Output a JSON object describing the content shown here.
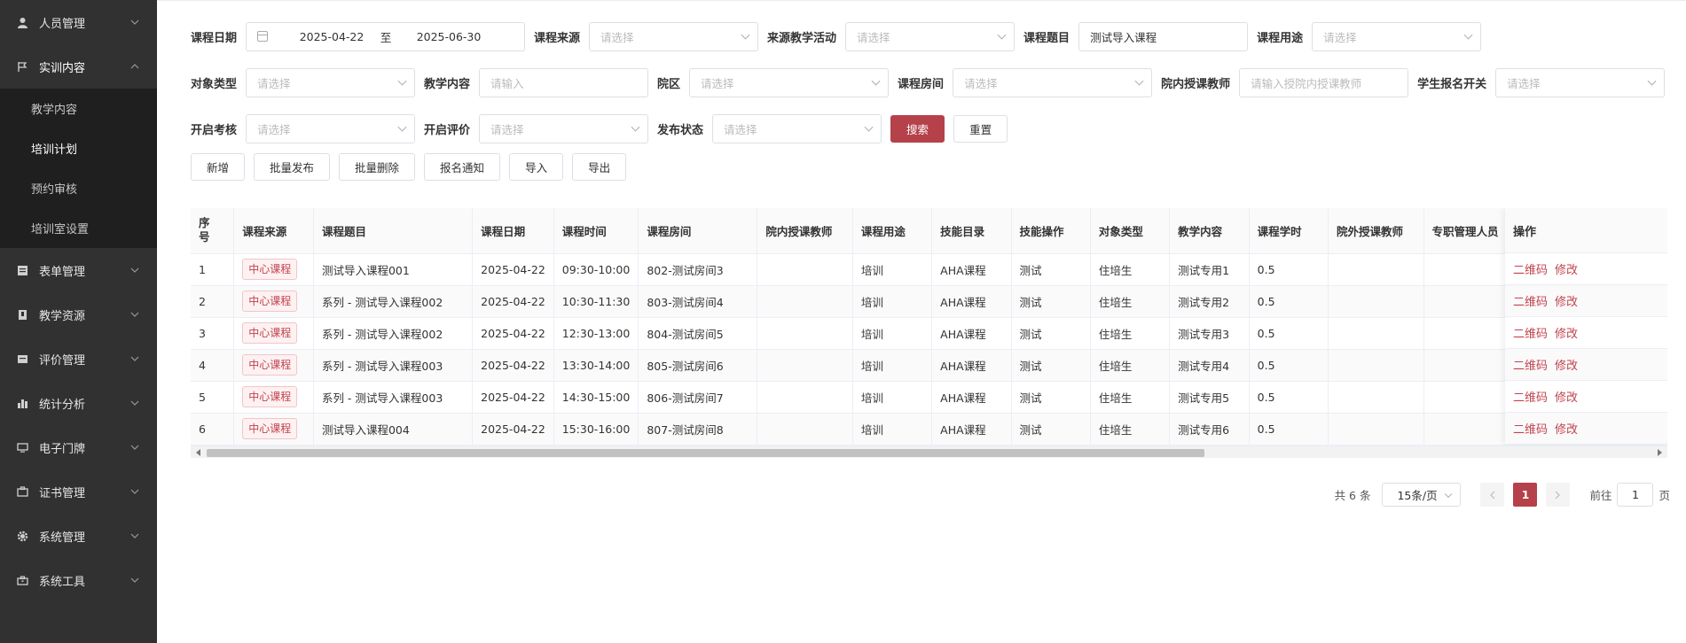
{
  "sidebar": {
    "items": [
      {
        "label": "人员管理",
        "icon": "user-icon"
      },
      {
        "label": "实训内容",
        "icon": "flag-icon",
        "expanded": true,
        "children": [
          {
            "label": "教学内容"
          },
          {
            "label": "培训计划",
            "active": true
          },
          {
            "label": "预约审核"
          },
          {
            "label": "培训室设置"
          }
        ]
      },
      {
        "label": "表单管理",
        "icon": "form-icon"
      },
      {
        "label": "教学资源",
        "icon": "book-icon"
      },
      {
        "label": "评价管理",
        "icon": "card-icon"
      },
      {
        "label": "统计分析",
        "icon": "bar-chart-icon"
      },
      {
        "label": "电子门牌",
        "icon": "monitor-icon"
      },
      {
        "label": "证书管理",
        "icon": "certificate-icon"
      },
      {
        "label": "系统管理",
        "icon": "gear-icon"
      },
      {
        "label": "系统工具",
        "icon": "toolbox-icon"
      }
    ]
  },
  "filters": {
    "course_date": {
      "label": "课程日期",
      "start": "2025-04-22",
      "sep": "至",
      "end": "2025-06-30"
    },
    "course_source": {
      "label": "课程来源",
      "placeholder": "请选择"
    },
    "source_activity": {
      "label": "来源教学活动",
      "placeholder": "请选择"
    },
    "course_title": {
      "label": "课程题目",
      "value": "测试导入课程"
    },
    "course_usage": {
      "label": "课程用途",
      "placeholder": "请选择"
    },
    "target_type": {
      "label": "对象类型",
      "placeholder": "请选择"
    },
    "teaching_content": {
      "label": "教学内容",
      "placeholder": "请输入"
    },
    "campus": {
      "label": "院区",
      "placeholder": "请选择"
    },
    "course_room": {
      "label": "课程房间",
      "placeholder": "请选择"
    },
    "internal_teacher": {
      "label": "院内授课教师",
      "placeholder": "请输入授院内授课教师"
    },
    "student_signup": {
      "label": "学生报名开关",
      "placeholder": "请选择"
    },
    "enable_exam": {
      "label": "开启考核",
      "placeholder": "请选择"
    },
    "enable_eval": {
      "label": "开启评价",
      "placeholder": "请选择"
    },
    "publish_status": {
      "label": "发布状态",
      "placeholder": "请选择"
    },
    "search_label": "搜索",
    "reset_label": "重置"
  },
  "toolbar": {
    "add": "新增",
    "batch_publish": "批量发布",
    "batch_delete": "批量删除",
    "signup_notice": "报名通知",
    "import": "导入",
    "export": "导出"
  },
  "table": {
    "headers": [
      "序号",
      "课程来源",
      "课程题目",
      "课程日期",
      "课程时间",
      "课程房间",
      "院内授课教师",
      "课程用途",
      "技能目录",
      "技能操作",
      "对象类型",
      "教学内容",
      "课程学时",
      "院外授课教师",
      "专职管理人员",
      "操作"
    ],
    "rows": [
      {
        "no": "1",
        "source": "中心课程",
        "title": "测试导入课程001",
        "date": "2025-04-22",
        "time": "09:30-10:00",
        "room": "802-测试房间3",
        "teacher": "",
        "usage": "培训",
        "skill_dir": "AHA课程",
        "skill_op": "测试",
        "target": "住培生",
        "content": "测试专用1",
        "hours": "0.5",
        "ext_teacher": "",
        "manager": ""
      },
      {
        "no": "2",
        "source": "中心课程",
        "title": "系列 - 测试导入课程002",
        "date": "2025-04-22",
        "time": "10:30-11:30",
        "room": "803-测试房间4",
        "teacher": "",
        "usage": "培训",
        "skill_dir": "AHA课程",
        "skill_op": "测试",
        "target": "住培生",
        "content": "测试专用2",
        "hours": "0.5",
        "ext_teacher": "",
        "manager": ""
      },
      {
        "no": "3",
        "source": "中心课程",
        "title": "系列 - 测试导入课程002",
        "date": "2025-04-22",
        "time": "12:30-13:00",
        "room": "804-测试房间5",
        "teacher": "",
        "usage": "培训",
        "skill_dir": "AHA课程",
        "skill_op": "测试",
        "target": "住培生",
        "content": "测试专用3",
        "hours": "0.5",
        "ext_teacher": "",
        "manager": ""
      },
      {
        "no": "4",
        "source": "中心课程",
        "title": "系列 - 测试导入课程003",
        "date": "2025-04-22",
        "time": "13:30-14:00",
        "room": "805-测试房间6",
        "teacher": "",
        "usage": "培训",
        "skill_dir": "AHA课程",
        "skill_op": "测试",
        "target": "住培生",
        "content": "测试专用4",
        "hours": "0.5",
        "ext_teacher": "",
        "manager": ""
      },
      {
        "no": "5",
        "source": "中心课程",
        "title": "系列 - 测试导入课程003",
        "date": "2025-04-22",
        "time": "14:30-15:00",
        "room": "806-测试房间7",
        "teacher": "",
        "usage": "培训",
        "skill_dir": "AHA课程",
        "skill_op": "测试",
        "target": "住培生",
        "content": "测试专用5",
        "hours": "0.5",
        "ext_teacher": "",
        "manager": ""
      },
      {
        "no": "6",
        "source": "中心课程",
        "title": "测试导入课程004",
        "date": "2025-04-22",
        "time": "15:30-16:00",
        "room": "807-测试房间8",
        "teacher": "",
        "usage": "培训",
        "skill_dir": "AHA课程",
        "skill_op": "测试",
        "target": "住培生",
        "content": "测试专用6",
        "hours": "0.5",
        "ext_teacher": "",
        "manager": ""
      }
    ],
    "op_qrcode": "二维码",
    "op_edit": "修改"
  },
  "pagination": {
    "total": "共 6 条",
    "page_size": "15条/页",
    "current_page": "1",
    "goto_label": "前往",
    "goto_value": "1",
    "page_unit": "页"
  },
  "colors": {
    "accent": "#b5414a",
    "sidebar_bg": "#313131",
    "submenu_bg": "#1f1f1f"
  }
}
